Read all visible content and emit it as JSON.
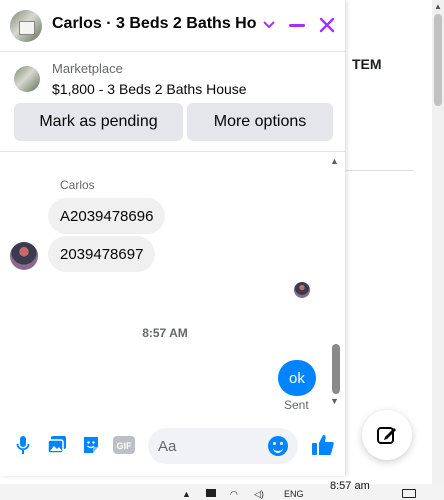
{
  "background": {
    "partial_text": "TEM"
  },
  "chat": {
    "title": "Carlos · 3 Beds 2 Baths Ho…",
    "marketplace": {
      "label": "Marketplace",
      "item": "$1,800 - 3 Beds 2 Baths House",
      "mark_pending_label": "Mark as pending",
      "more_options_label": "More options"
    },
    "messages": {
      "sender_name": "Carlos",
      "incoming": [
        "A2039478696",
        "2039478697"
      ],
      "timestamp": "8:57 AM",
      "outgoing": "ok",
      "status": "Sent"
    },
    "composer": {
      "placeholder": "Aa",
      "gif_label": "GIF"
    }
  },
  "taskbar": {
    "language": "ENG",
    "time": "8:57 am"
  },
  "colors": {
    "accent_purple": "#a033ff",
    "messenger_blue": "#0084ff",
    "bubble_grey": "#f0f0f0"
  }
}
